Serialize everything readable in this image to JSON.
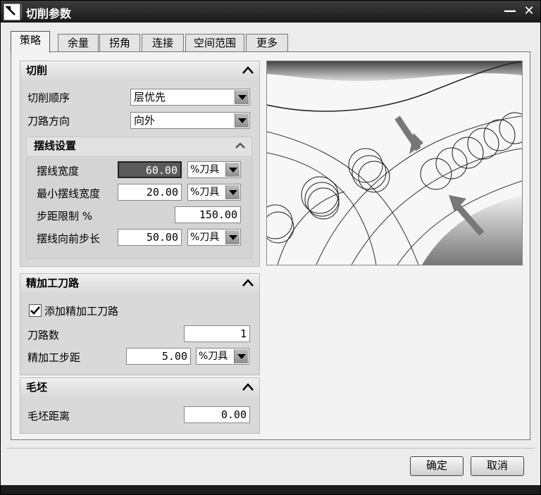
{
  "window": {
    "title": "切削参数",
    "minimize_label": "—",
    "close_label": "✕"
  },
  "tabs": [
    {
      "label": "策略"
    },
    {
      "label": "余量"
    },
    {
      "label": "拐角"
    },
    {
      "label": "连接"
    },
    {
      "label": "空间范围"
    },
    {
      "label": "更多"
    }
  ],
  "cutting": {
    "title": "切削",
    "order": {
      "label": "切削顺序",
      "value": "层优先"
    },
    "direction": {
      "label": "刀路方向",
      "value": "向外"
    },
    "trochoid": {
      "title": "摆线设置",
      "width": {
        "label": "摆线宽度",
        "value": "60.00",
        "unit": "%刀具"
      },
      "min_width": {
        "label": "最小摆线宽度",
        "value": "20.00",
        "unit": "%刀具"
      },
      "step_limit": {
        "label": "步距限制 %",
        "value": "150.00"
      },
      "forward_step": {
        "label": "摆线向前步长",
        "value": "50.00",
        "unit": "%刀具"
      }
    }
  },
  "finish": {
    "title": "精加工刀路",
    "add_finish": {
      "label": "添加精加工刀路",
      "checked": true
    },
    "passes": {
      "label": "刀路数",
      "value": "1"
    },
    "stepover": {
      "label": "精加工步距",
      "value": "5.00",
      "unit": "%刀具"
    }
  },
  "blank": {
    "title": "毛坯",
    "distance": {
      "label": "毛坯距离",
      "value": "0.00"
    }
  },
  "buttons": {
    "ok": "确定",
    "cancel": "取消"
  },
  "preview_image": "trochoidal-milling-diagram"
}
